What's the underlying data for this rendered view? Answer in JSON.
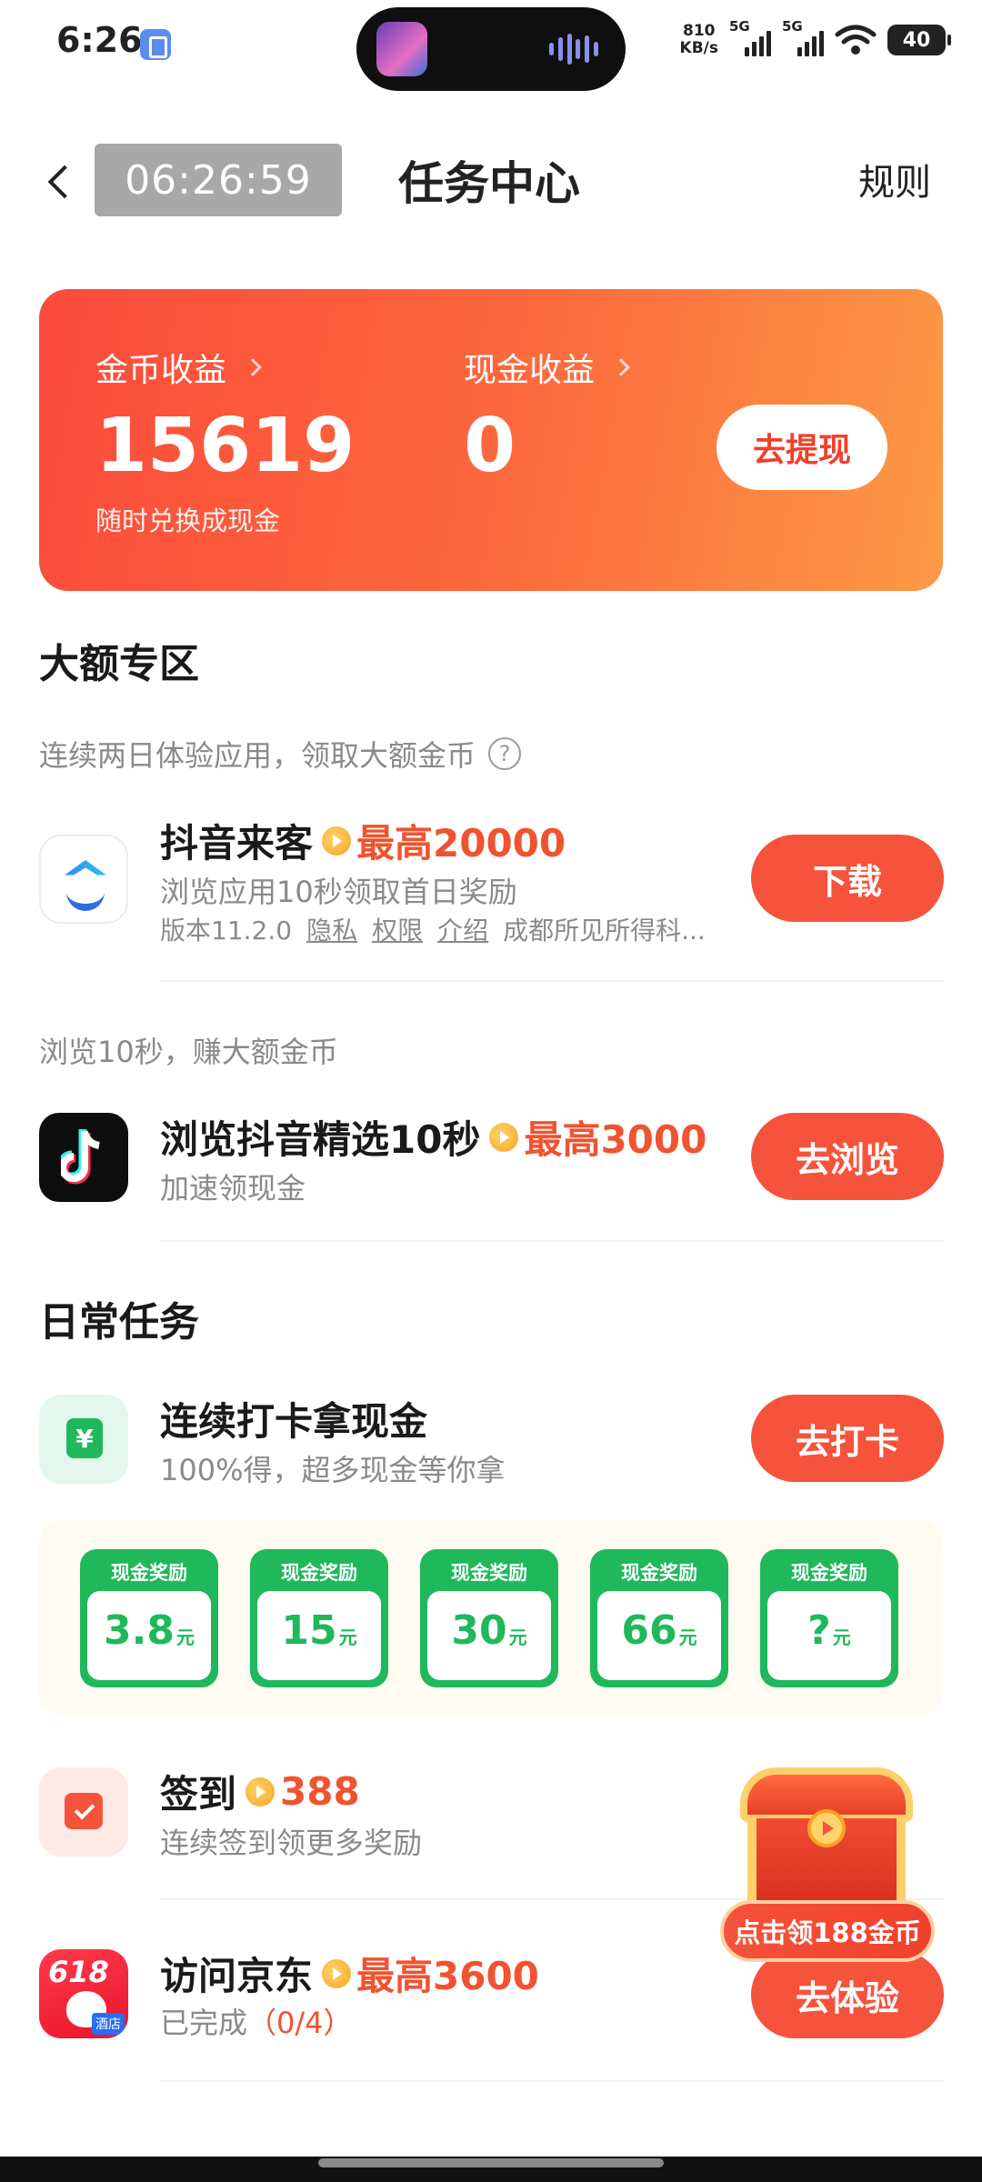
{
  "status_bar": {
    "time": "6:26",
    "net_speed_value": "810",
    "net_speed_unit": "KB/s",
    "sim1": "5G",
    "sim2": "5G",
    "battery": "40"
  },
  "header": {
    "timer": "06:26:59",
    "title": "任务中心",
    "rules": "规则"
  },
  "earnings": {
    "coin_label": "金币收益",
    "coin_value": "15619",
    "coin_sub": "随时兑换成现金",
    "cash_label": "现金收益",
    "cash_value": "0",
    "withdraw": "去提现"
  },
  "big_zone": {
    "title": "大额专区",
    "subtitle": "连续两日体验应用，领取大额金币",
    "help": "?",
    "app_task": {
      "title": "抖音来客",
      "reward": "最高20000",
      "desc": "浏览应用10秒领取首日奖励",
      "version": "版本11.2.0",
      "privacy": "隐私",
      "permissions": "权限",
      "intro": "介绍",
      "developer": "成都所见所得科...",
      "button": "下载"
    },
    "browse_sub": "浏览10秒，赚大额金币",
    "browse_task": {
      "title": "浏览抖音精选10秒",
      "reward": "最高3000",
      "desc": "加速领现金",
      "button": "去浏览"
    }
  },
  "daily": {
    "title": "日常任务",
    "checkin_task": {
      "title": "连续打卡拿现金",
      "desc": "100%得，超多现金等你拿",
      "button": "去打卡"
    },
    "cash_rewards": [
      {
        "label": "现金奖励",
        "amount": "3.8",
        "unit": "元"
      },
      {
        "label": "现金奖励",
        "amount": "15",
        "unit": "元"
      },
      {
        "label": "现金奖励",
        "amount": "30",
        "unit": "元"
      },
      {
        "label": "现金奖励",
        "amount": "66",
        "unit": "元"
      },
      {
        "label": "现金奖励",
        "amount": "?",
        "unit": "元"
      }
    ],
    "sign_task": {
      "title": "签到",
      "reward": "388",
      "desc": "连续签到领更多奖励"
    },
    "jd_task": {
      "title": "访问京东",
      "reward": "最高3600",
      "desc": "已完成",
      "progress": "（0/4）",
      "button": "去体验",
      "icon_number": "618",
      "icon_tag": "酒店"
    }
  },
  "chest": {
    "banner": "点击领188金币"
  },
  "colors": {
    "accent": "#f5533c",
    "green": "#1fb85a",
    "card_gradient_start": "#fb4a3c",
    "card_gradient_end": "#fd9a46"
  }
}
